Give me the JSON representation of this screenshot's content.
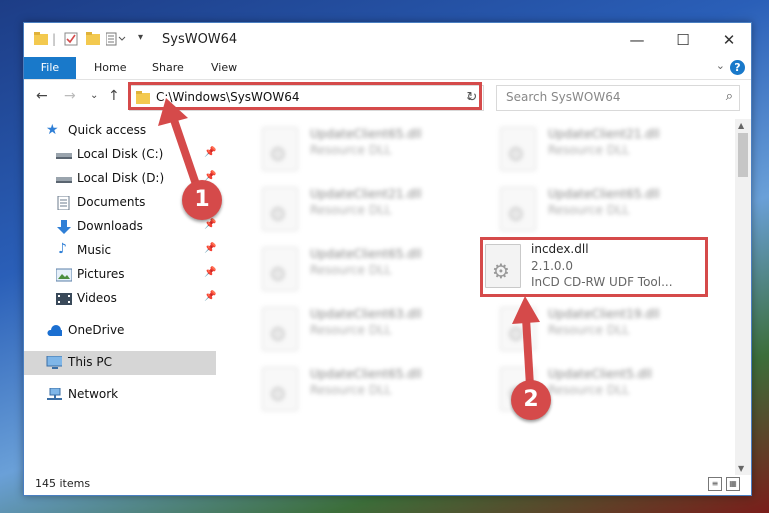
{
  "window": {
    "title": "SysWOW64",
    "controls": {
      "minimize": "—",
      "maximize": "☐",
      "close": "✕"
    }
  },
  "ribbon": {
    "tabs": [
      {
        "label": "File"
      },
      {
        "label": "Home"
      },
      {
        "label": "Share"
      },
      {
        "label": "View"
      }
    ],
    "help": "?"
  },
  "address_bar": {
    "path": "C:\\Windows\\SysWOW64"
  },
  "search": {
    "placeholder": "Search SysWOW64"
  },
  "sidebar": {
    "items": [
      {
        "label": "Quick access",
        "icon": "star-icon"
      },
      {
        "label": "Local Disk (C:)",
        "icon": "drive-icon",
        "pinned": true
      },
      {
        "label": "Local Disk (D:)",
        "icon": "drive-icon",
        "pinned": true
      },
      {
        "label": "Documents",
        "icon": "documents-icon",
        "pinned": true
      },
      {
        "label": "Downloads",
        "icon": "download-icon",
        "pinned": true
      },
      {
        "label": "Music",
        "icon": "music-icon",
        "pinned": true
      },
      {
        "label": "Pictures",
        "icon": "pictures-icon",
        "pinned": true
      },
      {
        "label": "Videos",
        "icon": "videos-icon",
        "pinned": true
      },
      {
        "label": "OneDrive",
        "icon": "cloud-icon"
      },
      {
        "label": "This PC",
        "icon": "pc-icon",
        "selected": true
      },
      {
        "label": "Network",
        "icon": "network-icon"
      }
    ]
  },
  "files": [
    {
      "name": "UpdateClient65.dll",
      "type": "Resource DLL"
    },
    {
      "name": "UpdateClient21.dll",
      "type": "Resource DLL"
    },
    {
      "name": "UpdateClient21.dll",
      "type": "Resource DLL"
    },
    {
      "name": "UpdateClient65.dll",
      "type": "Resource DLL"
    },
    {
      "name": "UpdateClient65.dll",
      "type": "Resource DLL"
    },
    {
      "name": "incdex.dll",
      "version": "2.1.0.0",
      "description": "InCD CD-RW UDF Tool..."
    },
    {
      "name": "UpdateClient63.dll",
      "type": "Resource DLL"
    },
    {
      "name": "UpdateClient19.dll",
      "type": "Resource DLL"
    },
    {
      "name": "UpdateClient65.dll",
      "type": "Resource DLL"
    },
    {
      "name": "UpdateClient5.dll",
      "type": "Resource DLL"
    }
  ],
  "status": {
    "count": "145 items"
  },
  "annotations": {
    "step1": "1",
    "step2": "2",
    "color": "#d54a4a"
  }
}
